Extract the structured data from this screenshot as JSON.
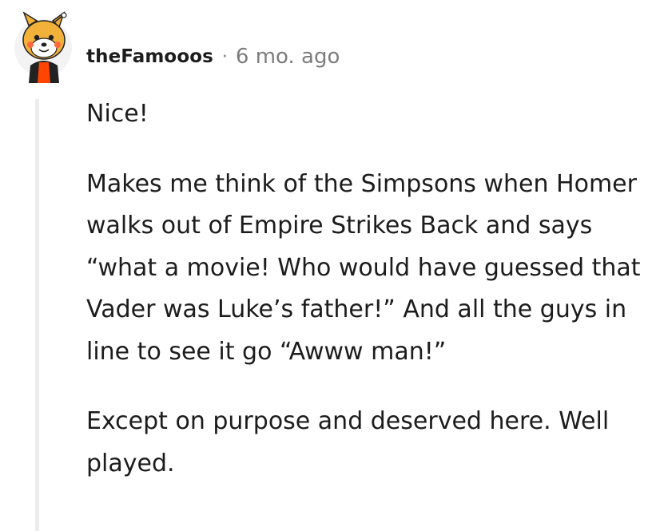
{
  "comment": {
    "author": "theFamooos",
    "separator": "·",
    "timestamp": "6 mo. ago",
    "avatar_icon": "snoo-doge-avatar-icon",
    "paragraphs": [
      "Nice!",
      "Makes me think of the Simpsons when Homer walks out of Empire Strikes Back and says “what a movie! Who would have guessed that Vader was Luke’s father!” And all the guys in line to see it go “Awww man!”",
      "Except on purpose and deserved here. Well played."
    ]
  },
  "colors": {
    "text": "#1c1c1c",
    "meta": "#7c7c7c",
    "thread_line": "#ececec",
    "avatar_face": "#f2b23a",
    "avatar_accent": "#ff4500"
  }
}
